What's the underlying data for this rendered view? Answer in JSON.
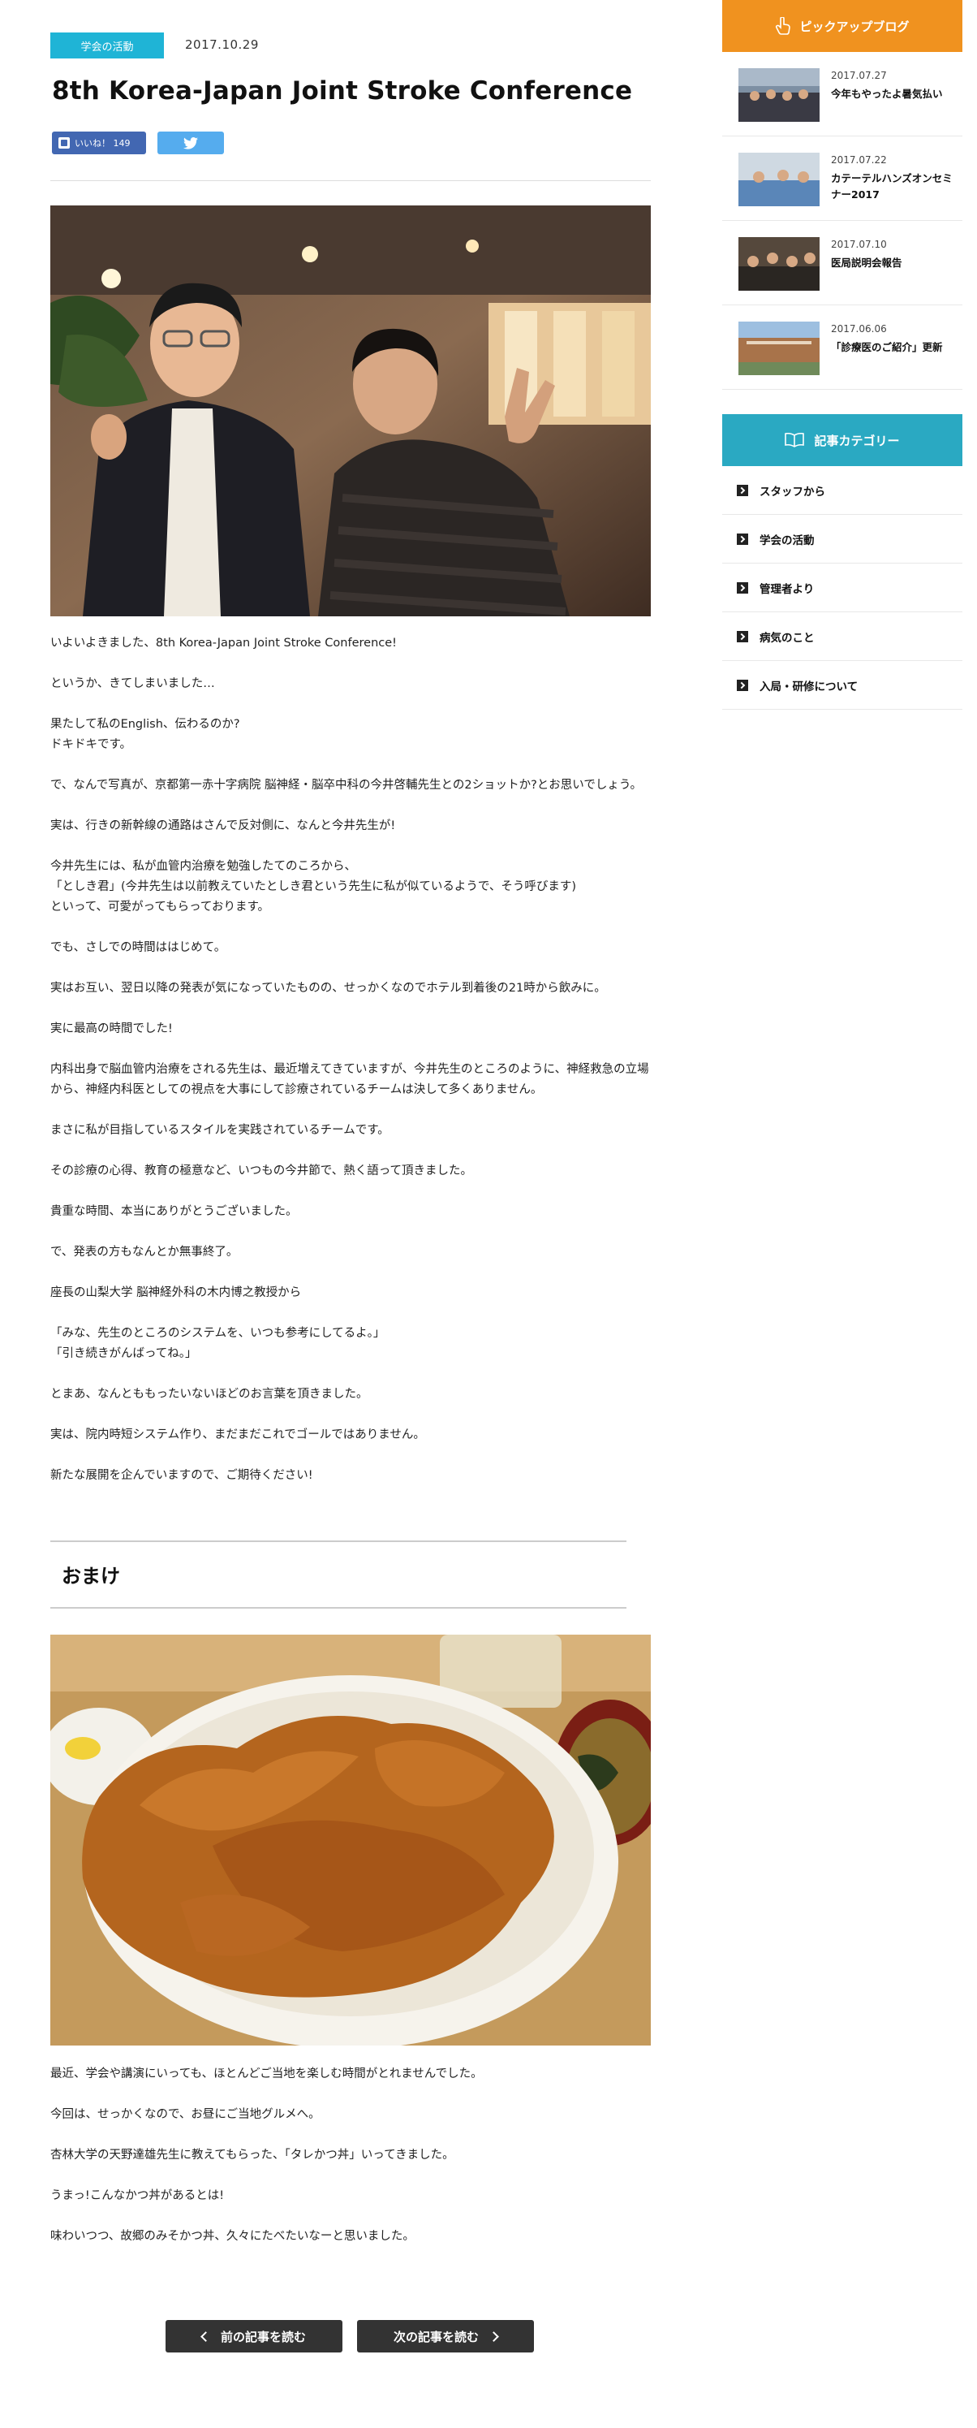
{
  "post": {
    "category": "学会の活動",
    "date": "2017.10.29",
    "title": "8th Korea-Japan Joint Stroke Conference",
    "like_label": "いいね！ 149",
    "tweet_icon": "twitter-bird-icon"
  },
  "article": {
    "paragraphs": [
      "いよいよきました、8th Korea-Japan Joint Stroke Conference!",
      "というか、きてしまいました…",
      "果たして私のEnglish、伝わるのか?\nドキドキです。",
      "で、なんで写真が、京都第一赤十字病院 脳神経・脳卒中科の今井啓輔先生との2ショットか?とお思いでしょう。",
      "実は、行きの新幹線の通路はさんで反対側に、なんと今井先生が!",
      "今井先生には、私が血管内治療を勉強したてのころから、\n「としき君」(今井先生は以前教えていたとしき君という先生に私が似ているようで、そう呼びます)\nといって、可愛がってもらっております。",
      "でも、さしでの時間ははじめて。",
      "実はお互い、翌日以降の発表が気になっていたものの、せっかくなのでホテル到着後の21時から飲みに。",
      "実に最高の時間でした!",
      "内科出身で脳血管内治療をされる先生は、最近増えてきていますが、今井先生のところのように、神経救急の立場から、神経内科医としての視点を大事にして診療されているチームは決して多くありません。",
      "まさに私が目指しているスタイルを実践されているチームです。",
      "その診療の心得、教育の極意など、いつもの今井節で、熱く語って頂きました。",
      "貴重な時間、本当にありがとうございました。",
      "で、発表の方もなんとか無事終了。",
      "座長の山梨大学 脳神経外科の木内博之教授から",
      "「みな、先生のところのシステムを、いつも参考にしてるよ。」\n「引き続きがんばってね。」",
      "とまあ、なんとももったいないほどのお言葉を頂きました。",
      "実は、院内時短システム作り、まだまだこれでゴールではありません。",
      "新たな展開を企んでいますので、ご期待ください!"
    ]
  },
  "omake": {
    "heading": "おまけ",
    "paragraphs": [
      "最近、学会や講演にいっても、ほとんどご当地を楽しむ時間がとれませんでした。",
      "今回は、せっかくなので、お昼にご当地グルメへ。",
      "杏林大学の天野達雄先生に教えてもらった、「タレかつ丼」いってきました。",
      "うまっ!こんなかつ丼があるとは!",
      "味わいつつ、故郷のみそかつ丼、久々にたべたいなーと思いました。"
    ]
  },
  "pager": {
    "prev_label": "前の記事を読む",
    "next_label": "次の記事を読む"
  },
  "sidebar": {
    "pickup": {
      "heading": "ピックアップブログ",
      "icon": "pointing-hand-icon",
      "items": [
        {
          "date": "2017.07.27",
          "title": "今年もやったよ暑気払い"
        },
        {
          "date": "2017.07.22",
          "title": "カテーテルハンズオンセミナー2017"
        },
        {
          "date": "2017.07.10",
          "title": "医局説明会報告"
        },
        {
          "date": "2017.06.06",
          "title": "「診療医のご紹介」更新"
        }
      ]
    },
    "categories": {
      "heading": "記事カテゴリー",
      "icon": "open-book-icon",
      "items": [
        "スタッフから",
        "学会の活動",
        "管理者より",
        "病気のこと",
        "入局・研修について"
      ]
    }
  }
}
